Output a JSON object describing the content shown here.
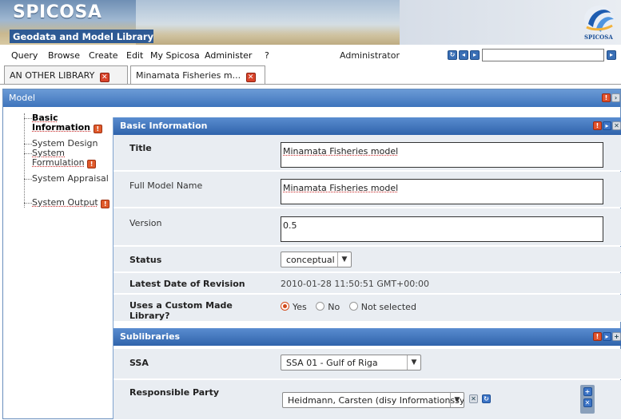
{
  "banner": {
    "title": "SPICOSA",
    "subtitle": "Geodata and Model Library",
    "logo_text": "SPICOSA"
  },
  "menu": {
    "items": [
      "Query",
      "Browse",
      "Create",
      "Edit",
      "My Spicosa",
      "Administer",
      "?"
    ],
    "user": "Administrator",
    "search_value": ""
  },
  "tabs": [
    {
      "label": "AN OTHER LIBRARY",
      "active": false
    },
    {
      "label": "Minamata Fisheries m...",
      "active": true
    }
  ],
  "model_panel": {
    "title": "Model",
    "tree": [
      {
        "label": "Basic Information",
        "active": true,
        "warning": true
      },
      {
        "label": "System Design",
        "active": false,
        "warning": false
      },
      {
        "label": "System Formulation",
        "active": false,
        "warning": true
      },
      {
        "label": "System Appraisal",
        "active": false,
        "warning": false
      },
      {
        "label": "System Output",
        "active": false,
        "warning": true
      }
    ]
  },
  "basic_info": {
    "header": "Basic Information",
    "title_label": "Title",
    "title_value": "Minamata Fisheries model",
    "full_name_label": "Full Model Name",
    "full_name_value": "Minamata Fisheries model",
    "version_label": "Version",
    "version_value": "0.5",
    "status_label": "Status",
    "status_value": "conceptual",
    "revision_label": "Latest Date of Revision",
    "revision_value": "2010-01-28 11:50:51 GMT+00:00",
    "custom_lib_label": "Uses a Custom Made Library?",
    "custom_lib_options": [
      "Yes",
      "No",
      "Not selected"
    ],
    "custom_lib_selected": "Yes"
  },
  "sublibraries": {
    "header": "Sublibraries",
    "ssa_label": "SSA",
    "ssa_value": "SSA 01 - Gulf of Riga",
    "party_label": "Responsible Party",
    "party_value": "Heidmann, Carsten (disy Informationssyst..."
  },
  "colors": {
    "header_blue": "#3e74bc",
    "row_bg": "#e9edf2",
    "warning_red": "#e05a2b"
  }
}
